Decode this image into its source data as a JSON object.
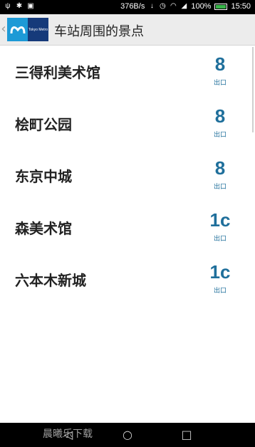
{
  "status_bar": {
    "speed": "376B/s",
    "battery_percent": "100%",
    "time": "15:50",
    "icons": [
      "usb-icon",
      "bug-icon",
      "image-icon",
      "download-icon",
      "signal-icon",
      "wifi-icon",
      "alarm-icon",
      "battery-icon"
    ]
  },
  "app_bar": {
    "title": "车站周围的景点",
    "logo_text": "Tokyo Metro",
    "brand_colors": {
      "light": "#1d9ad6",
      "dark": "#163a7a"
    }
  },
  "list": {
    "items": [
      {
        "name": "三得利美术馆",
        "exit": "8",
        "exit_label": "出口"
      },
      {
        "name": "桧町公园",
        "exit": "8",
        "exit_label": "出口"
      },
      {
        "name": "东京中城",
        "exit": "8",
        "exit_label": "出口"
      },
      {
        "name": "森美术馆",
        "exit": "1c",
        "exit_label": "出口"
      },
      {
        "name": "六本木新城",
        "exit": "1c",
        "exit_label": "出口"
      }
    ],
    "accent_color": "#1f6f9b"
  },
  "nav_bar": {
    "buttons": [
      "back-icon",
      "home-icon",
      "recent-apps-icon"
    ]
  },
  "watermark": {
    "text": "晨曦乐下载"
  }
}
